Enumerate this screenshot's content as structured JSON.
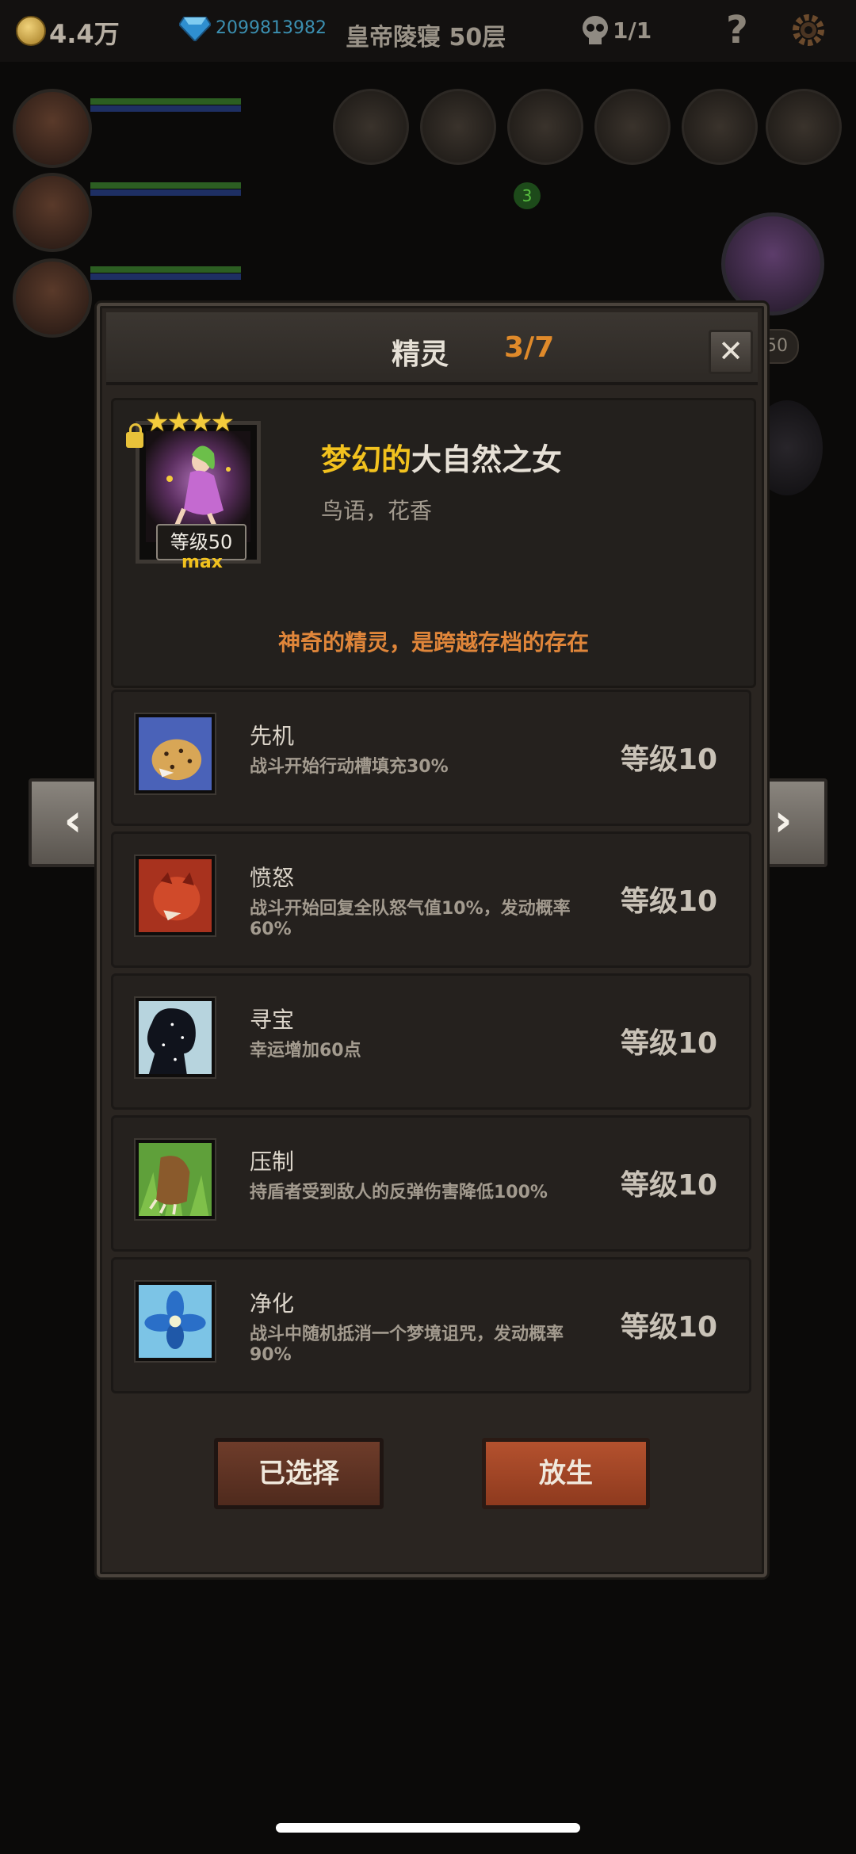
{
  "topbar": {
    "gold": "4.4万",
    "gems": "2099813982",
    "stage": "皇帝陵寝 50层",
    "skull_count": "1/1",
    "help": "?"
  },
  "hud": {
    "equip_badge": "3",
    "portrait_level": "50"
  },
  "modal": {
    "title": "精灵",
    "count": "3/7",
    "close": "✕",
    "spirit": {
      "stars": "★★★★",
      "level_tag": "等级50",
      "max_tag": "max",
      "name_prefix": "梦幻的",
      "name_main": "大自然之女",
      "desc": "鸟语，花香",
      "tagline": "神奇的精灵，是跨越存档的存在"
    },
    "skills": [
      {
        "name": "先机",
        "desc": "战斗开始行动槽填充30%",
        "level": "等级10",
        "icon": "leopard-icon"
      },
      {
        "name": "愤怒",
        "desc": "战斗开始回复全队怒气值10%，发动概率60%",
        "level": "等级10",
        "icon": "red-panther-icon"
      },
      {
        "name": "寻宝",
        "desc": "幸运增加60点",
        "level": "等级10",
        "icon": "starry-silhouette-icon"
      },
      {
        "name": "压制",
        "desc": "持盾者受到敌人的反弹伤害降低100%",
        "level": "等级10",
        "icon": "beast-claw-icon"
      },
      {
        "name": "净化",
        "desc": "战斗中随机抵消一个梦境诅咒，发动概率90%",
        "level": "等级10",
        "icon": "blue-flower-icon"
      }
    ],
    "buttons": {
      "selected": "已选择",
      "release": "放生"
    },
    "nav": {
      "prev": "‹",
      "next": "›"
    }
  },
  "colors": {
    "accent_orange": "#e08a2a",
    "gold_text": "#f2c21e",
    "tagline": "#e0863a"
  }
}
